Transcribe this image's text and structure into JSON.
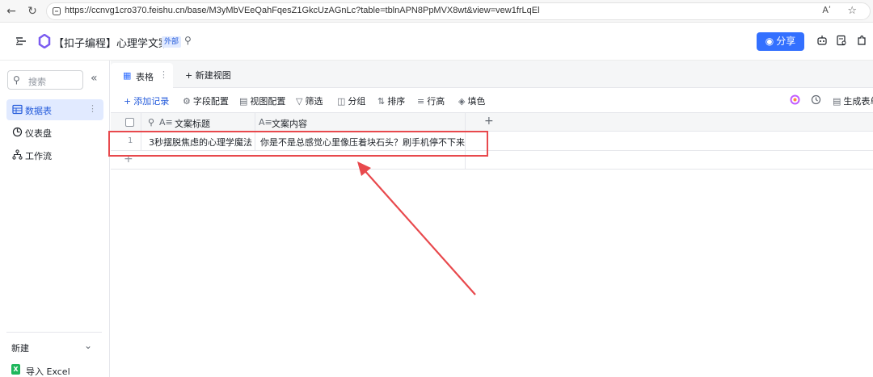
{
  "browser": {
    "url": "https://ccnvg1cro370.feishu.cn/base/M3yMbVEeQahFqesZ1GkcUzAGnLc?table=tblnAPN8PpMVX8wt&view=vew1frLqEl",
    "read_aloud_label": "Aʹ"
  },
  "header": {
    "title": "【扣子编程】心理学文案",
    "badge": "外部",
    "share_label": "分享"
  },
  "sidebar": {
    "search_placeholder": "搜索",
    "items": [
      {
        "label": "数据表",
        "icon": "table-icon",
        "active": true
      },
      {
        "label": "仪表盘",
        "icon": "dashboard-icon",
        "active": false
      },
      {
        "label": "工作流",
        "icon": "workflow-icon",
        "active": false
      }
    ],
    "new_label": "新建",
    "import_excel_label": "导入 Excel"
  },
  "tabs": {
    "active_tab": "表格",
    "new_view": "新建视图"
  },
  "toolbar": {
    "add_record": "添加记录",
    "field_config": "字段配置",
    "view_config": "视图配置",
    "filter": "筛选",
    "group": "分组",
    "sort": "排序",
    "row_height": "行高",
    "fill_color": "填色",
    "generate": "生成表单"
  },
  "grid": {
    "columns": [
      "文案标题",
      "文案内容"
    ],
    "rows": [
      {
        "num": "1",
        "title": "3秒摆脱焦虑的心理学魔法",
        "content": "你是不是总感觉心里像压着块石头？刷手机停不下来..."
      }
    ]
  },
  "colors": {
    "accent": "#3370ff",
    "annotation": "#e8494d"
  }
}
